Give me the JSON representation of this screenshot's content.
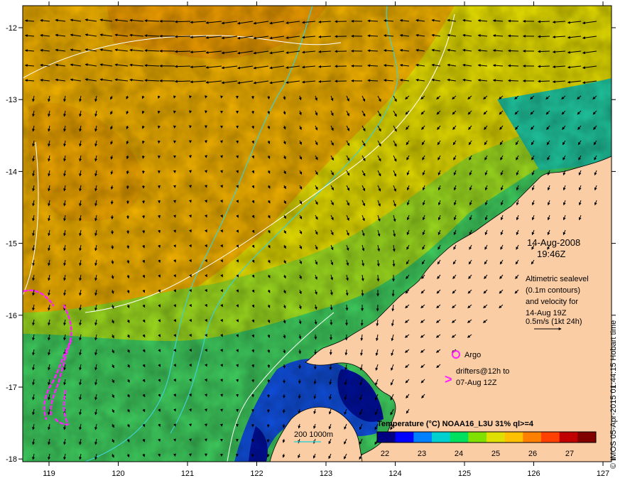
{
  "map": {
    "x_ticks": [
      "119",
      "120",
      "121",
      "122",
      "123",
      "124",
      "125",
      "126",
      "127"
    ],
    "y_ticks": [
      "-12",
      "-13",
      "-14",
      "-15",
      "-16",
      "-17",
      "-18"
    ],
    "date": "14-Aug-2008",
    "time": "19:46Z",
    "altimetry_lines": [
      "Altimetric sealevel",
      "(0.1m contours)",
      "and velocity for",
      "14-Aug 19Z",
      "0.5m/s (1kt 24h)"
    ],
    "argo_label": "Argo",
    "drifters_lines": [
      "drifters@12h to",
      "07-Aug 12Z"
    ],
    "drifter_marker": ">",
    "depth_legend": "200  1000m",
    "colorbar": {
      "title": "Temperature (°C) NOAA16_L3U 31% ql>=4",
      "labels": [
        "22",
        "23",
        "24",
        "25",
        "26",
        "27"
      ],
      "colors": [
        "#000080",
        "#0000ff",
        "#0080ff",
        "#00d0d0",
        "#00e060",
        "#80e000",
        "#e0e000",
        "#ffc000",
        "#ff8000",
        "#ff4000",
        "#c00000",
        "#800000"
      ]
    },
    "credit": "© IMOS 05-Apr-2015 01:44:15 Hobart time",
    "colors": {
      "land": "#fbcda5",
      "warm_sea": "#f5b400",
      "mid_sea": "#e8e000",
      "cool_sea": "#40d060",
      "cold_sea": "#0010a0",
      "contour": "#ffffff",
      "isobath": "#40d0d0",
      "drifter": "#ff20ff",
      "arrow": "#000000"
    }
  }
}
